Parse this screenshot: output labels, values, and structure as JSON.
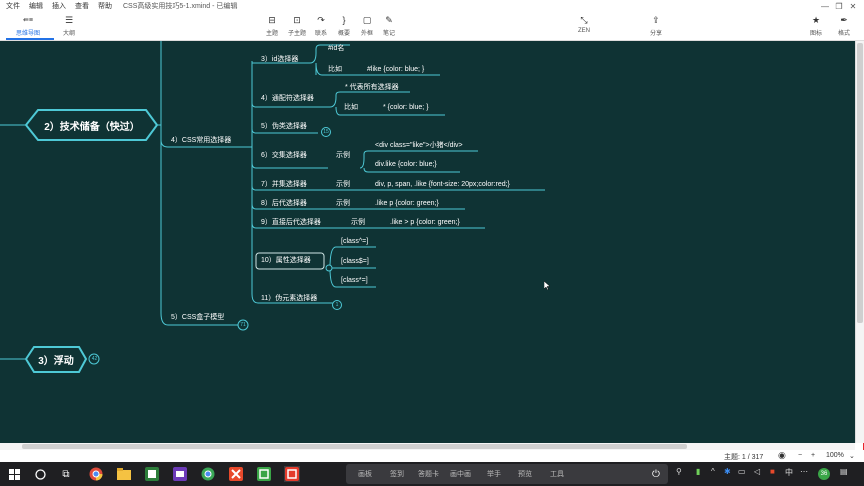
{
  "menubar": {
    "items": [
      "文件",
      "编辑",
      "插入",
      "查看",
      "帮助"
    ],
    "title": "CSS高级实用技巧5-1.xmind - 已编辑"
  },
  "window_controls": {
    "minimize": "—",
    "restore": "❐",
    "close": "✕"
  },
  "toolbar": {
    "views": [
      {
        "label": "思维导图",
        "icon": "mindmap-icon",
        "glyph": "⇚≡"
      },
      {
        "label": "大纲",
        "icon": "outline-icon",
        "glyph": "☰"
      }
    ],
    "insert": [
      {
        "label": "主题",
        "icon": "topic-icon",
        "glyph": "⊟"
      },
      {
        "label": "子主题",
        "icon": "subtopic-icon",
        "glyph": "⊡"
      },
      {
        "label": "联系",
        "icon": "relationship-icon",
        "glyph": "↷"
      },
      {
        "label": "概要",
        "icon": "summary-icon",
        "glyph": "}"
      },
      {
        "label": "外框",
        "icon": "boundary-icon",
        "glyph": "▢"
      },
      {
        "label": "笔记",
        "icon": "note-icon",
        "glyph": "✎"
      }
    ],
    "zen": {
      "label": "ZEN",
      "glyph": "⤡"
    },
    "share": {
      "label": "分享",
      "glyph": "⇪"
    },
    "icons": {
      "label": "图标",
      "glyph": "★"
    },
    "format": {
      "label": "格式",
      "glyph": "✒"
    }
  },
  "mindmap": {
    "main_topics": [
      "2）技术储备（快过）",
      "3）浮动"
    ],
    "float_badge": "42",
    "css_selectors": {
      "label": "4）CSS常用选择器",
      "children": [
        {
          "label": "3）id选择器",
          "sub": [
            "#id名",
            "比如",
            "#like {color: blue; }"
          ]
        },
        {
          "label": "4）通配符选择器",
          "sub": [
            "* 代表所有选择器",
            "比如",
            "* {color: blue; }"
          ]
        },
        {
          "label": "5）伪类选择器",
          "badge": "15"
        },
        {
          "label": "6）交集选择器",
          "sub": [
            "示例",
            "<div class=\"like\">小猪</div>",
            "div.like {color: blue;}"
          ]
        },
        {
          "label": "7）并集选择器",
          "sub": [
            "示例",
            "div, p, span, .like {font-size: 20px;color:red;}"
          ]
        },
        {
          "label": "8）后代选择器",
          "sub": [
            "示例",
            ".like p {color: green;}"
          ]
        },
        {
          "label": "9）直接后代选择器",
          "sub": [
            "示例",
            ".like > p {color: green;}"
          ]
        },
        {
          "label": "10）属性选择器",
          "sub": [
            "[class^=]",
            "[class$=]",
            "[class*=]"
          ]
        },
        {
          "label": "11）伪元素选择器",
          "badge": "1"
        }
      ]
    },
    "box_model": {
      "label": "5）CSS盒子模型",
      "badge": "71"
    }
  },
  "statusbar": {
    "topic_count": "主题: 1 / 317",
    "zoom": "100%",
    "minus": "−",
    "plus": "+"
  },
  "taskbar": {
    "apps": [
      "start-icon",
      "search-icon",
      "taskview-icon",
      "chrome-icon",
      "folder-icon",
      "wechat-icon",
      "chrome-icon",
      "xmind-icon",
      "camtasia-icon",
      "app-red-icon"
    ],
    "tabs": [
      "画板",
      "签到",
      "答题卡",
      "画中画",
      "举手",
      "预览",
      "工具"
    ],
    "tray": [
      "中",
      "36"
    ]
  }
}
